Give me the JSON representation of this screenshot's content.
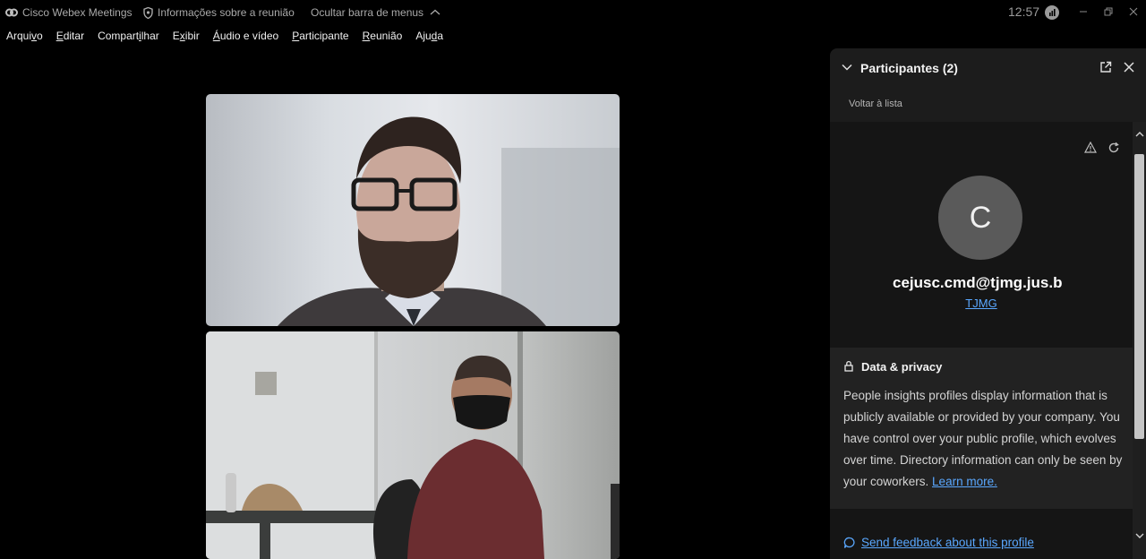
{
  "titlebar": {
    "app_name": "Cisco Webex Meetings",
    "meeting_info": "Informações sobre a reunião",
    "hide_menu": "Ocultar barra de menus",
    "clock": "12:57"
  },
  "menu": [
    {
      "pre": "Arqui",
      "u": "v",
      "post": "o"
    },
    {
      "pre": "",
      "u": "E",
      "post": "ditar"
    },
    {
      "pre": "Compart",
      "u": "i",
      "post": "lhar"
    },
    {
      "pre": "E",
      "u": "x",
      "post": "ibir"
    },
    {
      "pre": "",
      "u": "Á",
      "post": "udio e vídeo"
    },
    {
      "pre": "",
      "u": "P",
      "post": "articipante"
    },
    {
      "pre": "",
      "u": "R",
      "post": "eunião"
    },
    {
      "pre": "Aju",
      "u": "d",
      "post": "a"
    }
  ],
  "panel": {
    "title": "Participantes (2)",
    "back_link": "Voltar à lista",
    "profile": {
      "avatar_initial": "C",
      "email": "cejusc.cmd@tjmg.jus.b",
      "org": "TJMG"
    },
    "privacy": {
      "title": "Data & privacy",
      "text": "People insights profiles display information that is publicly available or provided by your company. You have control over your public profile, which evolves over time. Directory information can only be seen by your coworkers.",
      "learn_more": "Learn more."
    },
    "feedback": "Send feedback about this profile"
  },
  "colors": {
    "link": "#5aa8ff",
    "panel_bg": "#1c1c1c",
    "avatar_bg": "#5a5a5a"
  }
}
